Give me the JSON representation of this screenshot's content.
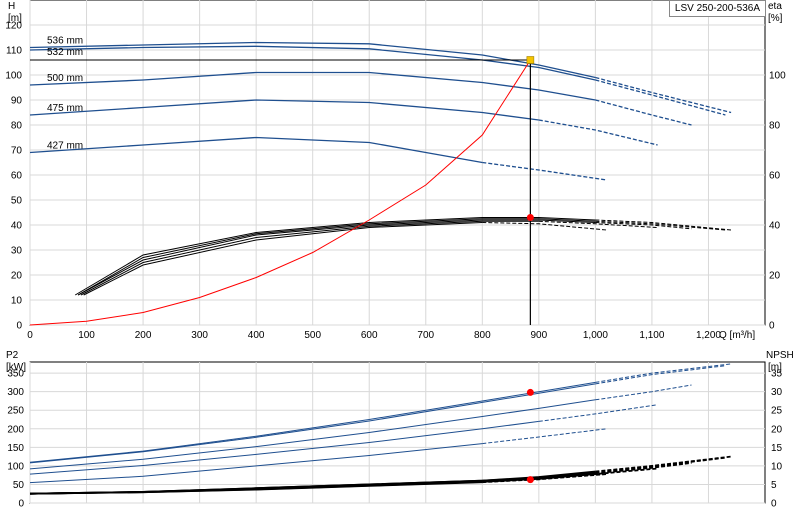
{
  "model_label": "LSV 250-200-536A",
  "chart_data": [
    {
      "type": "line",
      "panel": "head-efficiency",
      "xlabel": "Q [m³/h]",
      "xlim": [
        0,
        1300
      ],
      "x_ticks": [
        "0",
        "100",
        "200",
        "300",
        "400",
        "500",
        "600",
        "700",
        "800",
        "900",
        "1,000",
        "1,100",
        "1,200"
      ],
      "ylabel_left": [
        "H",
        "[m]"
      ],
      "ylim_left": [
        0,
        130
      ],
      "y_ticks_left": [
        "0",
        "10",
        "20",
        "30",
        "40",
        "50",
        "60",
        "70",
        "80",
        "90",
        "100",
        "110",
        "120"
      ],
      "ylabel_right": [
        "eta",
        "[%]"
      ],
      "ylim_right": [
        0,
        130
      ],
      "y_ticks_right": [
        "0",
        "20",
        "40",
        "60",
        "80",
        "100"
      ],
      "grid": true,
      "curve_labels": [
        "536 mm",
        "532 mm",
        "500 mm",
        "475 mm",
        "427 mm"
      ],
      "head_curves": [
        {
          "name": "536 mm",
          "color": "#1f4f8f",
          "x": [
            0,
            200,
            400,
            600,
            800,
            900,
            1000,
            1100,
            1240
          ],
          "y": [
            111,
            112,
            113,
            112.5,
            108,
            104,
            99,
            93,
            85
          ]
        },
        {
          "name": "532 mm",
          "color": "#1f4f8f",
          "x": [
            0,
            200,
            400,
            600,
            800,
            900,
            1000,
            1100,
            1230
          ],
          "y": [
            110,
            111,
            111.5,
            110.5,
            106,
            103,
            98,
            92,
            84
          ]
        },
        {
          "name": "500 mm",
          "color": "#1f4f8f",
          "x": [
            0,
            200,
            400,
            600,
            800,
            900,
            1000,
            1100,
            1170
          ],
          "y": [
            96,
            98,
            101,
            101,
            97,
            94,
            90,
            84,
            80
          ]
        },
        {
          "name": "475 mm",
          "color": "#1f4f8f",
          "x": [
            0,
            200,
            400,
            600,
            800,
            900,
            1000,
            1110
          ],
          "y": [
            84,
            87,
            90,
            89,
            85,
            82,
            78,
            72
          ]
        },
        {
          "name": "427 mm",
          "color": "#1f4f8f",
          "x": [
            0,
            200,
            400,
            600,
            700,
            800,
            900,
            1020
          ],
          "y": [
            69,
            72,
            75,
            73,
            69,
            65,
            62,
            58
          ]
        }
      ],
      "efficiency_curves": [
        {
          "name": "536 mm",
          "color": "#000000",
          "x": [
            80,
            200,
            400,
            600,
            800,
            900,
            1000,
            1100,
            1240
          ],
          "y": [
            12,
            28,
            37,
            41,
            43,
            43,
            42,
            41,
            38
          ]
        },
        {
          "name": "532 mm",
          "color": "#000000",
          "x": [
            85,
            200,
            400,
            600,
            800,
            900,
            1000,
            1100,
            1230
          ],
          "y": [
            12,
            27,
            36.5,
            40.5,
            42.5,
            42.5,
            41.5,
            40.5,
            38
          ]
        },
        {
          "name": "500 mm",
          "color": "#000000",
          "x": [
            85,
            200,
            400,
            600,
            800,
            900,
            1000,
            1100,
            1170
          ],
          "y": [
            12,
            26,
            36,
            40,
            42,
            42,
            41,
            40,
            38.5
          ]
        },
        {
          "name": "475 mm",
          "color": "#000000",
          "x": [
            90,
            200,
            400,
            600,
            800,
            900,
            1000,
            1110
          ],
          "y": [
            12,
            25,
            35,
            39.5,
            41.5,
            41.5,
            40.5,
            39
          ]
        },
        {
          "name": "427 mm",
          "color": "#000000",
          "x": [
            95,
            200,
            400,
            600,
            800,
            900,
            1020
          ],
          "y": [
            12,
            24,
            34,
            39,
            41,
            40.5,
            38
          ]
        }
      ],
      "system_curve": {
        "color": "#ff0000",
        "x": [
          0,
          100,
          200,
          300,
          400,
          500,
          600,
          700,
          800,
          885
        ],
        "y": [
          0,
          1.5,
          5,
          11,
          19,
          29,
          42,
          56,
          76,
          106
        ]
      },
      "duty_point": {
        "x": 885,
        "head": 106,
        "eta": 43
      }
    },
    {
      "type": "line",
      "panel": "power-npsh",
      "xlim": [
        0,
        1300
      ],
      "ylabel_left": [
        "P2",
        "[kW]"
      ],
      "ylim_left": [
        0,
        380
      ],
      "y_ticks_left": [
        "0",
        "50",
        "100",
        "150",
        "200",
        "250",
        "300",
        "350"
      ],
      "ylabel_right": [
        "NPSH",
        "[m]"
      ],
      "ylim_right": [
        0,
        38
      ],
      "y_ticks_right": [
        "0",
        "5",
        "10",
        "15",
        "20",
        "25",
        "30",
        "35"
      ],
      "grid": true,
      "power_curves": [
        {
          "name": "536 mm",
          "color": "#1f4f8f",
          "x": [
            0,
            200,
            400,
            600,
            800,
            900,
            1000,
            1100,
            1240
          ],
          "y": [
            110,
            140,
            180,
            225,
            275,
            300,
            325,
            350,
            375
          ]
        },
        {
          "name": "532 mm",
          "color": "#1f4f8f",
          "x": [
            0,
            200,
            400,
            600,
            800,
            900,
            1000,
            1100,
            1230
          ],
          "y": [
            108,
            138,
            177,
            221,
            271,
            296,
            321,
            346,
            370
          ]
        },
        {
          "name": "500 mm",
          "color": "#1f4f8f",
          "x": [
            0,
            200,
            400,
            600,
            800,
            900,
            1000,
            1100,
            1170
          ],
          "y": [
            92,
            118,
            152,
            190,
            233,
            255,
            278,
            300,
            318
          ]
        },
        {
          "name": "475 mm",
          "color": "#1f4f8f",
          "x": [
            0,
            200,
            400,
            600,
            800,
            900,
            1000,
            1110
          ],
          "y": [
            78,
            101,
            131,
            163,
            200,
            220,
            240,
            265
          ]
        },
        {
          "name": "427 mm",
          "color": "#1f4f8f",
          "x": [
            0,
            200,
            400,
            600,
            800,
            900,
            1020
          ],
          "y": [
            55,
            72,
            100,
            128,
            160,
            178,
            200
          ]
        }
      ],
      "npsh_curves": [
        {
          "name": "536 mm",
          "color": "#000000",
          "x": [
            0,
            200,
            400,
            600,
            800,
            900,
            1000,
            1100,
            1240
          ],
          "y": [
            2.5,
            3,
            4,
            5,
            6,
            7,
            8.5,
            10,
            12.5
          ]
        },
        {
          "name": "532 mm",
          "color": "#000000",
          "x": [
            0,
            200,
            400,
            600,
            800,
            900,
            1000,
            1100,
            1230
          ],
          "y": [
            2.5,
            3,
            4,
            5,
            6,
            6.8,
            8.2,
            9.8,
            12.2
          ]
        },
        {
          "name": "500 mm",
          "color": "#000000",
          "x": [
            0,
            200,
            400,
            600,
            800,
            900,
            1000,
            1100,
            1170
          ],
          "y": [
            2.5,
            3,
            3.8,
            4.8,
            5.8,
            6.6,
            8,
            9.5,
            10.8
          ]
        },
        {
          "name": "475 mm",
          "color": "#000000",
          "x": [
            0,
            200,
            400,
            600,
            800,
            900,
            1000,
            1110
          ],
          "y": [
            2.5,
            2.9,
            3.7,
            4.7,
            5.7,
            6.5,
            7.8,
            9.3
          ]
        },
        {
          "name": "427 mm",
          "color": "#000000",
          "x": [
            0,
            200,
            400,
            600,
            800,
            900,
            1020
          ],
          "y": [
            2.5,
            2.9,
            3.6,
            4.6,
            5.6,
            6.4,
            7.8
          ]
        }
      ],
      "duty_point": {
        "x": 885,
        "power": 298,
        "npsh": 6.3
      }
    }
  ]
}
